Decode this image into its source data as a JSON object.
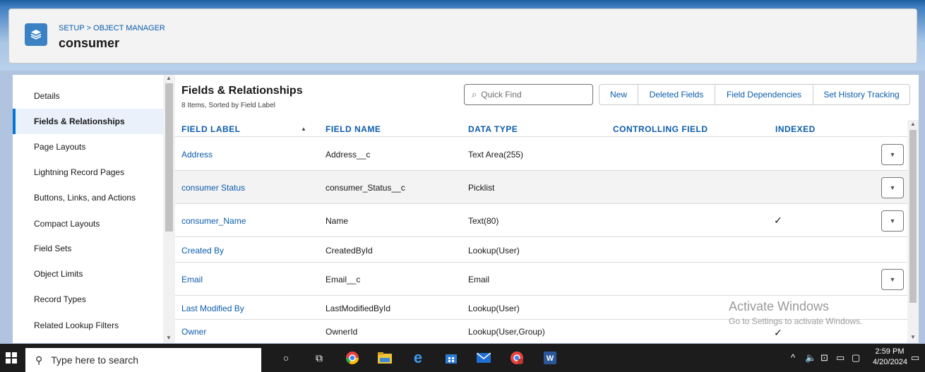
{
  "header": {
    "breadcrumb": "SETUP > OBJECT MANAGER",
    "object_name": "consumer",
    "icon": "layers-icon"
  },
  "sidebar": {
    "items": [
      {
        "label": "Details",
        "active": false
      },
      {
        "label": "Fields & Relationships",
        "active": true
      },
      {
        "label": "Page Layouts",
        "active": false
      },
      {
        "label": "Lightning Record Pages",
        "active": false
      },
      {
        "label": "Buttons, Links, and Actions",
        "active": false
      },
      {
        "label": "Compact Layouts",
        "active": false
      },
      {
        "label": "Field Sets",
        "active": false
      },
      {
        "label": "Object Limits",
        "active": false
      },
      {
        "label": "Record Types",
        "active": false
      },
      {
        "label": "Related Lookup Filters",
        "active": false
      }
    ]
  },
  "main": {
    "title": "Fields & Relationships",
    "subtitle": "8 Items, Sorted by Field Label",
    "quick_find_placeholder": "Quick Find",
    "buttons": [
      "New",
      "Deleted Fields",
      "Field Dependencies",
      "Set History Tracking"
    ],
    "columns": [
      "FIELD LABEL",
      "FIELD NAME",
      "DATA TYPE",
      "CONTROLLING FIELD",
      "INDEXED"
    ],
    "rows": [
      {
        "label": "Address",
        "name": "Address__c",
        "type": "Text Area(255)",
        "indexed": false,
        "menu": true
      },
      {
        "label": "consumer Status",
        "name": "consumer_Status__c",
        "type": "Picklist",
        "indexed": false,
        "menu": true
      },
      {
        "label": "consumer_Name",
        "name": "Name",
        "type": "Text(80)",
        "indexed": true,
        "menu": true
      },
      {
        "label": "Created By",
        "name": "CreatedById",
        "type": "Lookup(User)",
        "indexed": false,
        "menu": false
      },
      {
        "label": "Email",
        "name": "Email__c",
        "type": "Email",
        "indexed": false,
        "menu": true
      },
      {
        "label": "Last Modified By",
        "name": "LastModifiedById",
        "type": "Lookup(User)",
        "indexed": false,
        "menu": false
      },
      {
        "label": "Owner",
        "name": "OwnerId",
        "type": "Lookup(User,Group)",
        "indexed": true,
        "menu": false
      }
    ]
  },
  "watermark": {
    "line1": "Activate Windows",
    "line2": "Go to Settings to activate Windows."
  },
  "taskbar": {
    "search_placeholder": "Type here to search",
    "time": "2:59 PM",
    "date": "4/20/2024"
  }
}
